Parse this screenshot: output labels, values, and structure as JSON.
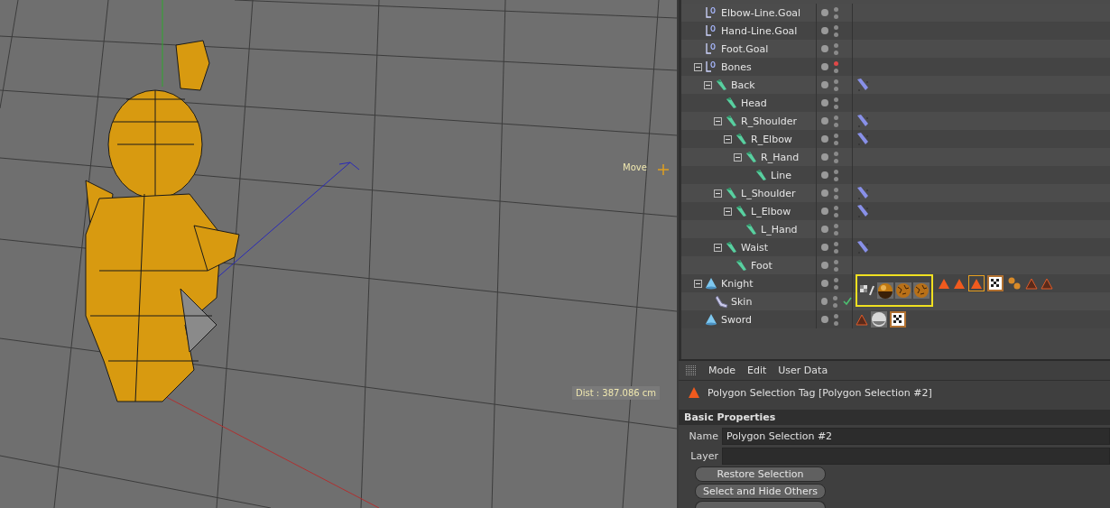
{
  "viewport": {
    "tool_label": "Move",
    "distance": "Dist : 387.086 cm"
  },
  "objects": [
    {
      "name": "Elbow-Line.Goal",
      "kind": "null",
      "editor_off": false
    },
    {
      "name": "Hand-Line.Goal",
      "kind": "null",
      "editor_off": false
    },
    {
      "name": "Foot.Goal",
      "kind": "null",
      "editor_off": false
    },
    {
      "name": "Bones",
      "kind": "null",
      "editor_off": true,
      "expanded": true,
      "children": [
        {
          "name": "Back",
          "kind": "bone",
          "editor_off": false,
          "expanded": true,
          "tags": [
            {
              "kind": "ik",
              "selected": false
            }
          ],
          "children": [
            {
              "name": "Head",
              "kind": "bone",
              "editor_off": false
            },
            {
              "name": "R_Shoulder",
              "kind": "bone",
              "editor_off": false,
              "expanded": true,
              "tags": [
                {
                  "kind": "ik",
                  "selected": false
                }
              ],
              "children": [
                {
                  "name": "R_Elbow",
                  "kind": "bone",
                  "editor_off": false,
                  "expanded": true,
                  "tags": [
                    {
                      "kind": "ik",
                      "selected": false
                    }
                  ],
                  "children": [
                    {
                      "name": "R_Hand",
                      "kind": "bone",
                      "editor_off": false,
                      "expanded": true,
                      "children": [
                        {
                          "name": "Line",
                          "kind": "bone",
                          "editor_off": false
                        }
                      ]
                    }
                  ]
                }
              ]
            },
            {
              "name": "L_Shoulder",
              "kind": "bone",
              "editor_off": false,
              "expanded": true,
              "tags": [
                {
                  "kind": "ik",
                  "selected": false
                }
              ],
              "children": [
                {
                  "name": "L_Elbow",
                  "kind": "bone",
                  "editor_off": false,
                  "expanded": true,
                  "tags": [
                    {
                      "kind": "ik",
                      "selected": false
                    }
                  ],
                  "children": [
                    {
                      "name": "L_Hand",
                      "kind": "bone",
                      "editor_off": false
                    }
                  ]
                }
              ]
            },
            {
              "name": "Waist",
              "kind": "bone",
              "editor_off": false,
              "expanded": true,
              "tags": [
                {
                  "kind": "ik",
                  "selected": false
                }
              ],
              "children": [
                {
                  "name": "Foot",
                  "kind": "bone",
                  "editor_off": false
                }
              ]
            }
          ]
        }
      ]
    },
    {
      "name": "Knight",
      "kind": "polygon",
      "editor_off": false,
      "expanded": true,
      "tags": [
        {
          "kind": "group",
          "highlighted": true,
          "tags": [
            {
              "kind": "display",
              "selected": false
            },
            {
              "kind": "material",
              "selected": false
            },
            {
              "kind": "roughmaterial",
              "selected": false
            },
            {
              "kind": "roughmaterial",
              "selected": false
            }
          ]
        },
        {
          "kind": "selection",
          "selected": false
        },
        {
          "kind": "selection",
          "selected": false
        },
        {
          "kind": "selection",
          "selected": true
        },
        {
          "kind": "texture",
          "selected": false
        },
        {
          "kind": "spheres",
          "selected": false
        },
        {
          "kind": "darkselection",
          "selected": false
        },
        {
          "kind": "darkselection",
          "selected": false
        }
      ],
      "children": [
        {
          "name": "Skin",
          "kind": "skin",
          "editor_off": false,
          "enabled": true
        }
      ]
    },
    {
      "name": "Sword",
      "kind": "polygon",
      "editor_off": false,
      "tags": [
        {
          "kind": "darkselection",
          "selected": false
        },
        {
          "kind": "whitematerial",
          "selected": false
        },
        {
          "kind": "texture",
          "selected": false
        }
      ]
    }
  ],
  "attributes": {
    "menu": [
      "Mode",
      "Edit",
      "User Data"
    ],
    "title": "Polygon Selection Tag [Polygon Selection #2]",
    "section": "Basic Properties",
    "fields": [
      {
        "label": "Name",
        "value": "Polygon Selection #2"
      },
      {
        "label": "Layer"
      }
    ],
    "buttons": [
      {
        "label": "Restore Selection",
        "cut_off": false
      },
      {
        "label": "Select and Hide Others",
        "cut_off": false
      },
      {
        "cut_off": true
      }
    ]
  }
}
